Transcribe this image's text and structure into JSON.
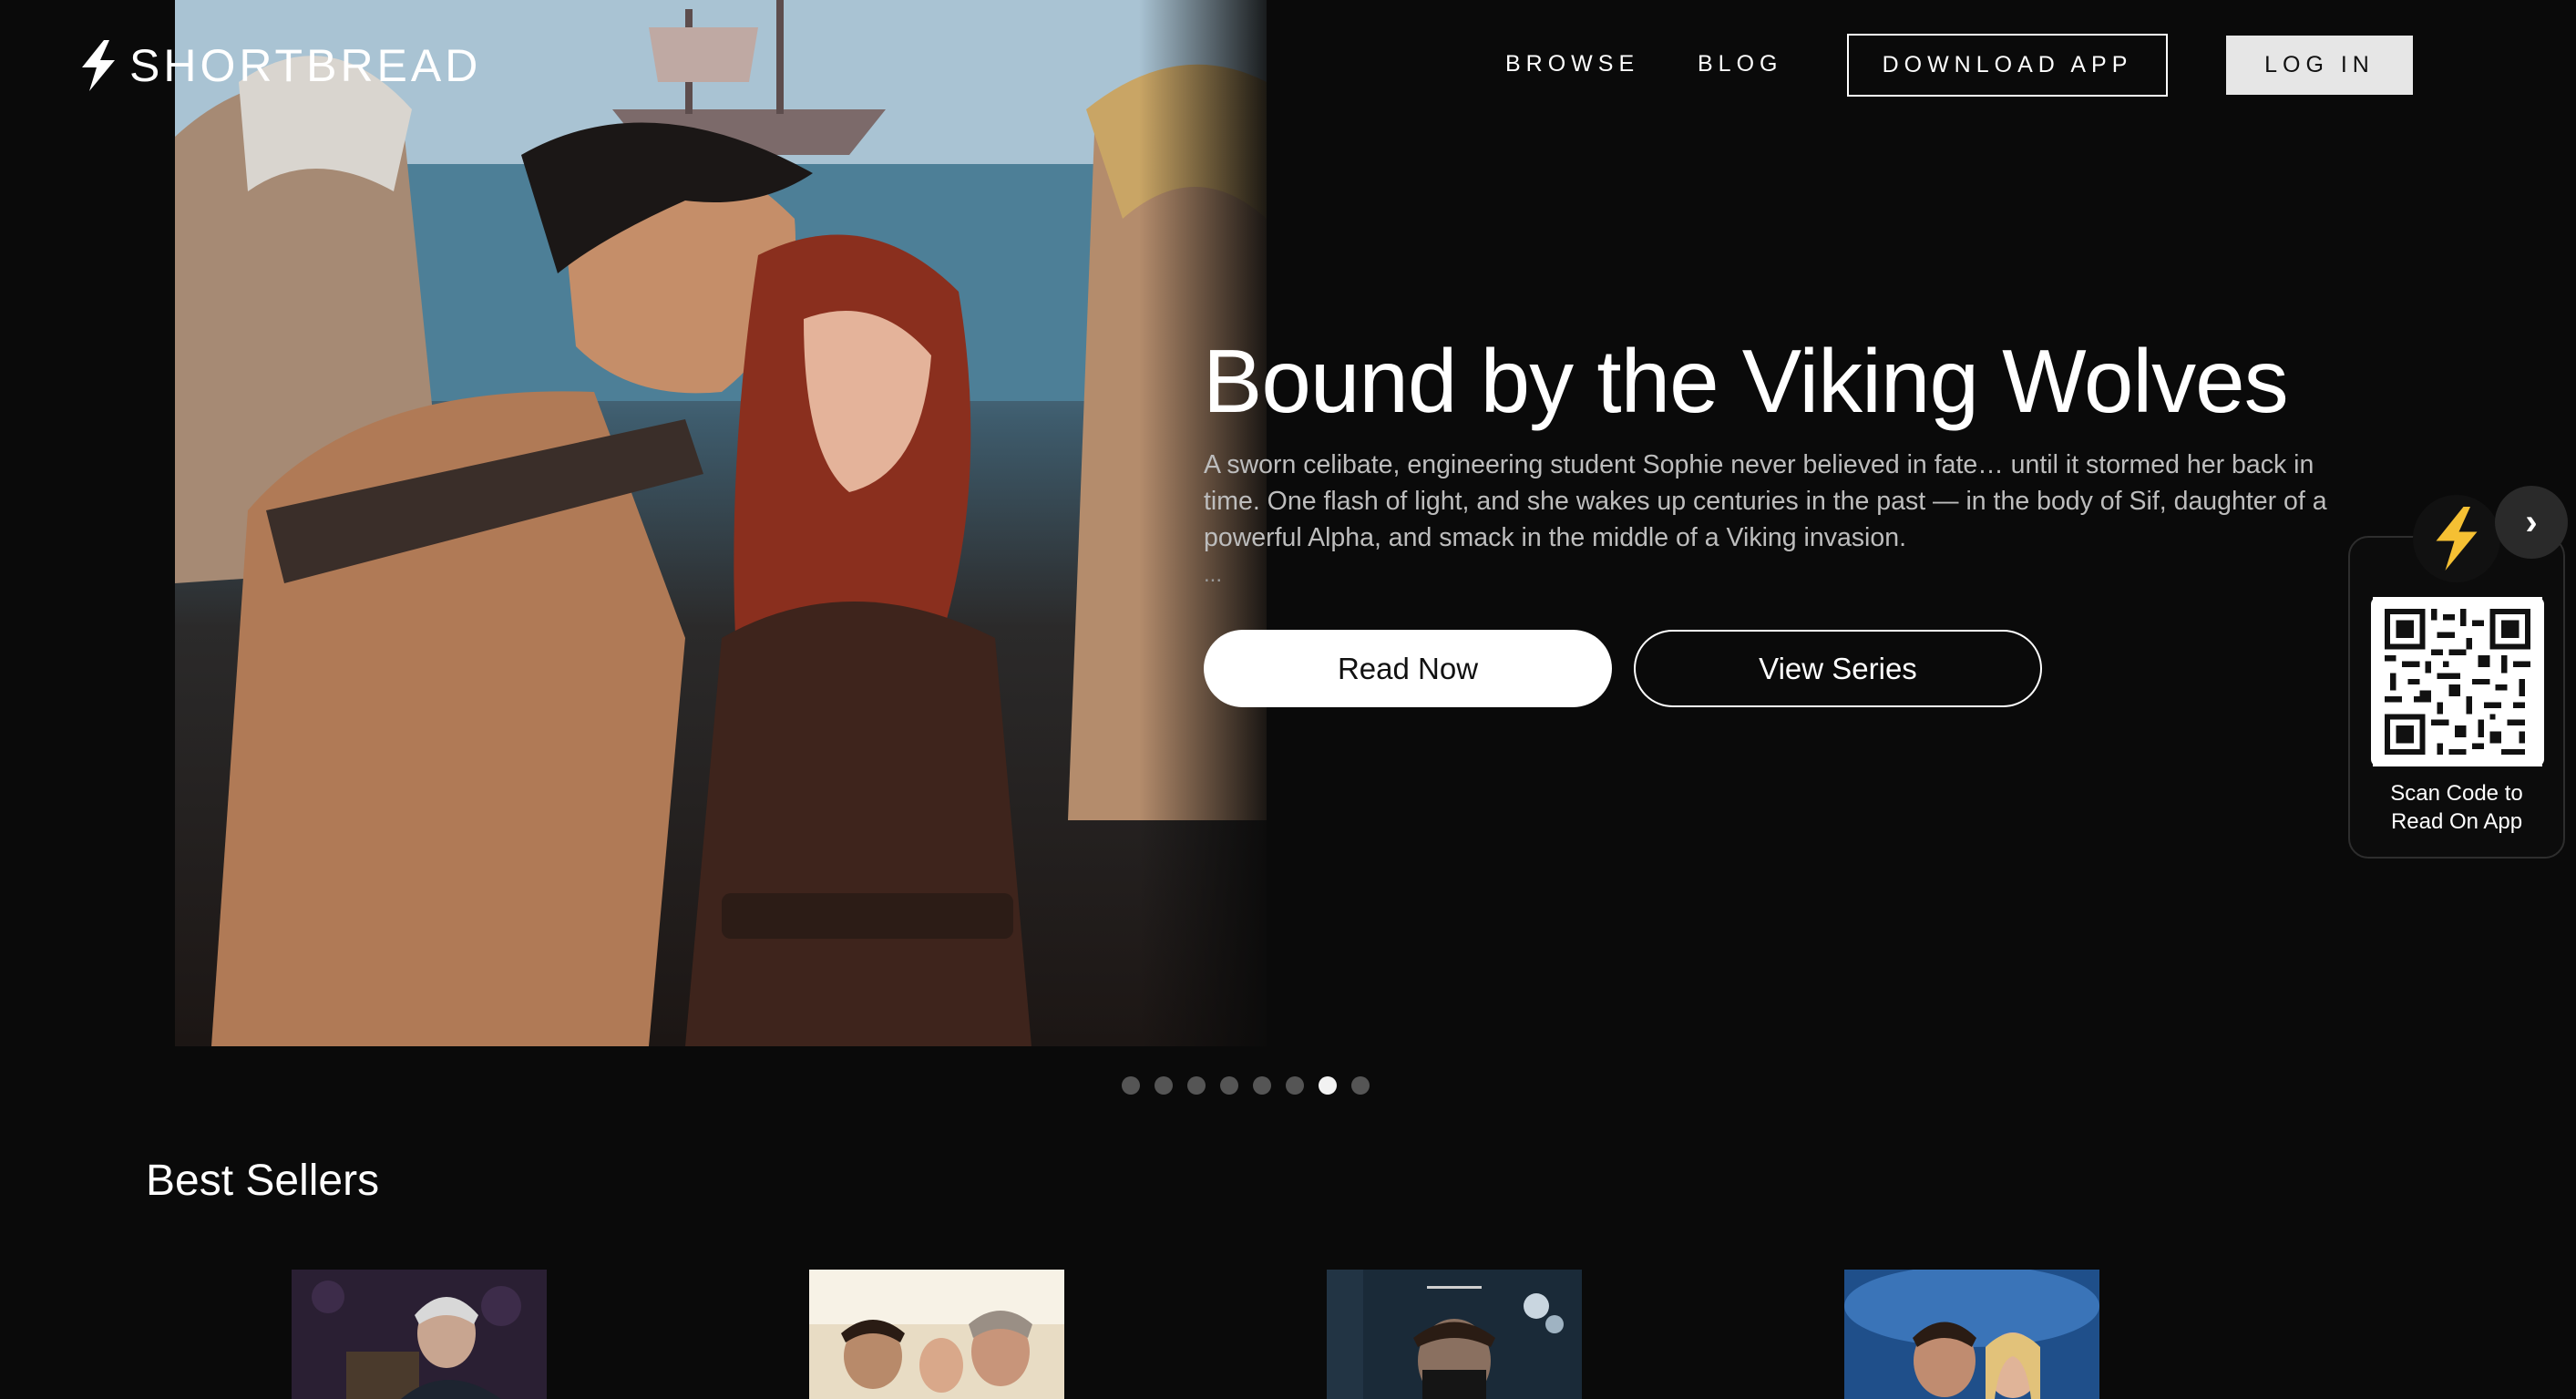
{
  "header": {
    "logo_text": "SHORTBREAD",
    "nav": {
      "browse": "BROWSE",
      "blog": "BLOG"
    },
    "download_label": "DOWNLOAD APP",
    "login_label": "LOG IN"
  },
  "hero": {
    "title": "Bound by the Viking Wolves",
    "description": "A sworn celibate, engineering student Sophie never believed in fate… until it stormed her back in time. One flash of light, and she wakes up centuries in the past — in the body of Sif, daughter of a powerful Alpha, and smack in the middle of a Viking invasion.",
    "ellipsis": "...",
    "read_now_label": "Read Now",
    "view_series_label": "View Series",
    "carousel": {
      "total_slides": 8,
      "active_slide": 7
    }
  },
  "qr_widget": {
    "next_arrow": "›",
    "caption_line1": "Scan Code to",
    "caption_line2": "Read On App"
  },
  "best_sellers": {
    "title": "Best Sellers",
    "books": [
      {
        "cover": "dark-purple-silver-haired-man"
      },
      {
        "cover": "warm-couple-trio"
      },
      {
        "cover": "masked-man-dark-blue"
      },
      {
        "cover": "blue-wolf-couple"
      }
    ]
  },
  "colors": {
    "background": "#0a0a0a",
    "text_primary": "#ffffff",
    "text_secondary": "#bdbdbd",
    "accent_bolt": "#f5c033",
    "dot_inactive": "#555555",
    "dot_active": "#f2f2f2"
  }
}
